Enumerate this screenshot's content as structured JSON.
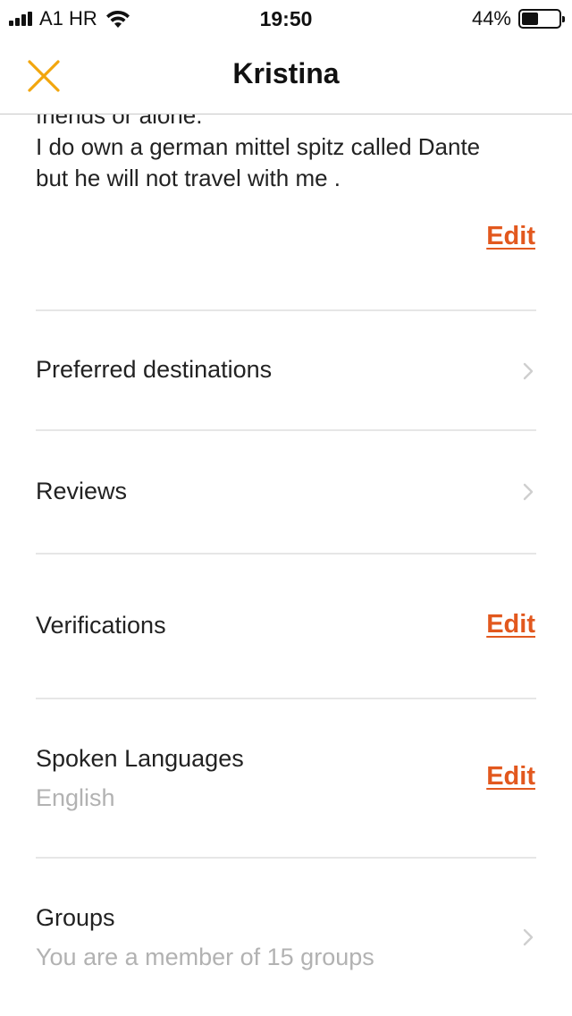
{
  "status_bar": {
    "carrier": "A1 HR",
    "time": "19:50",
    "battery_percent": "44%",
    "battery_level": 0.44
  },
  "nav": {
    "title": "Kristina",
    "close_icon": "close-icon"
  },
  "about": {
    "lines": [
      "friends or alone.",
      "I do own a german mittel spitz called Dante",
      "but he will not travel with me ."
    ],
    "edit_label": "Edit"
  },
  "sections": {
    "preferred_destinations": {
      "label": "Preferred destinations"
    },
    "reviews": {
      "label": "Reviews"
    },
    "verifications": {
      "label": "Verifications",
      "edit_label": "Edit"
    },
    "spoken_languages": {
      "label": "Spoken Languages",
      "value": "English",
      "edit_label": "Edit"
    },
    "groups": {
      "label": "Groups",
      "value": "You are a member of 15 groups"
    }
  },
  "colors": {
    "accent": "#e2581e",
    "close_icon": "#f2a60d",
    "secondary_text": "#b2b2b2",
    "divider": "#e6e6e6"
  }
}
